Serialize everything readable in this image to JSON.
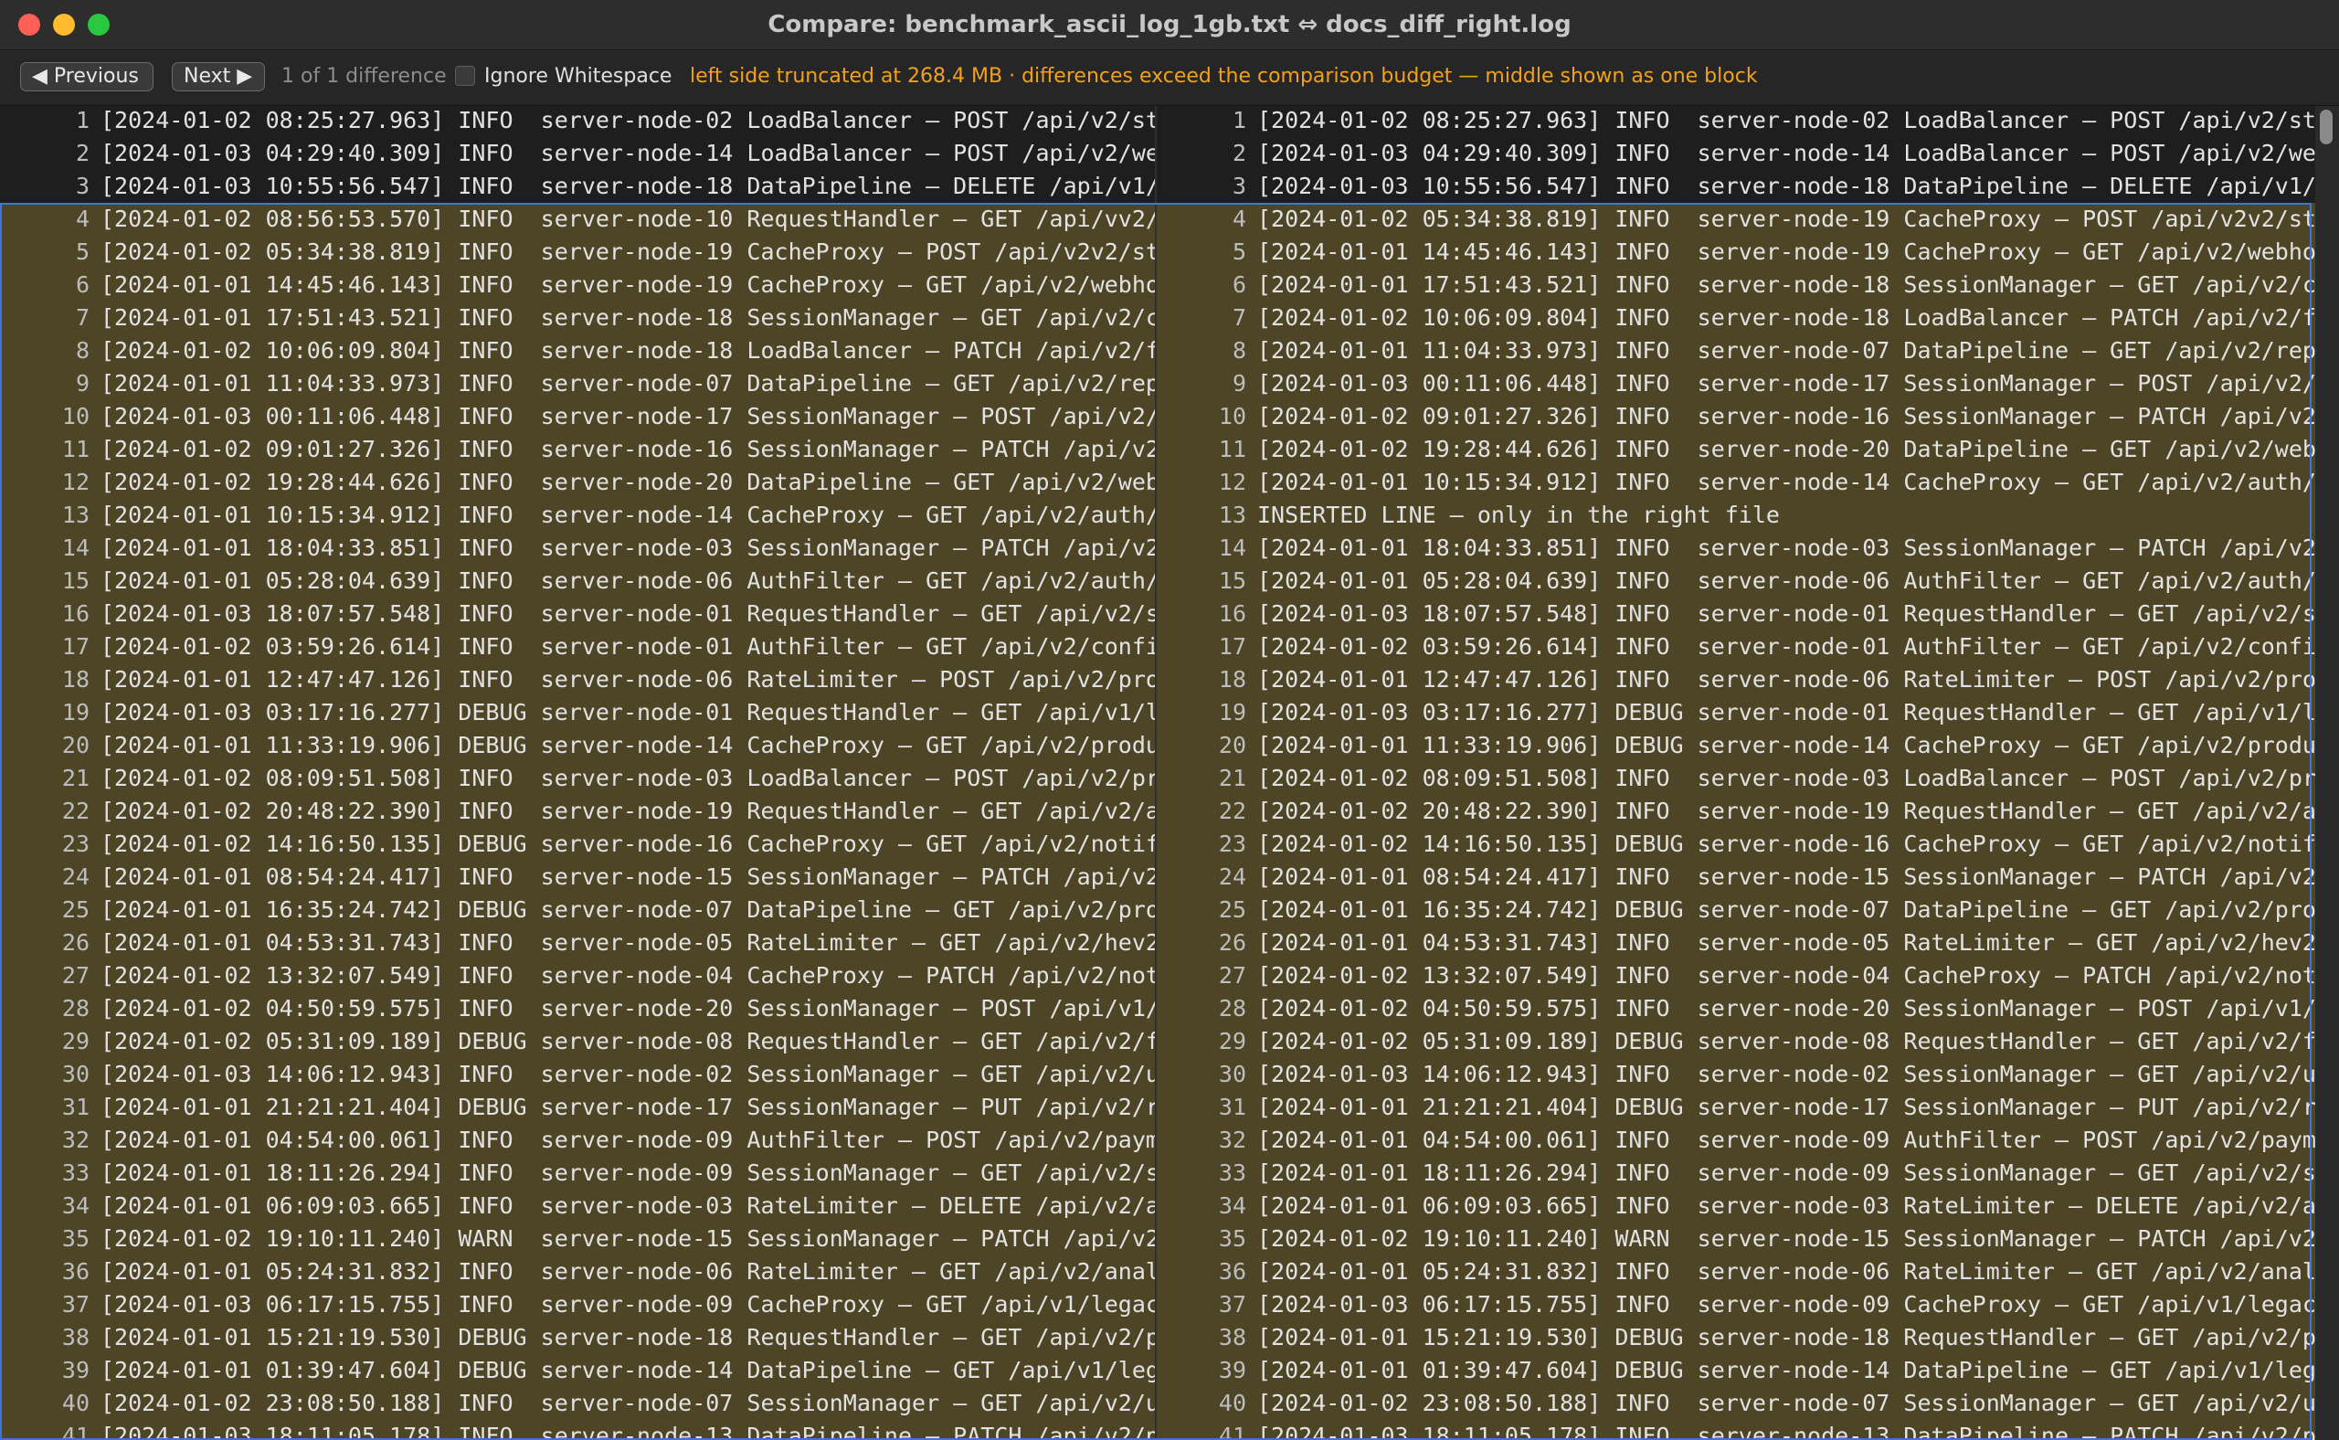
{
  "window": {
    "title": "Compare: benchmark_ascii_log_1gb.txt ⇔ docs_diff_right.log"
  },
  "toolbar": {
    "previous_label": "◀ Previous",
    "next_label": "Next ▶",
    "count_text": "1 of 1 difference",
    "ignore_whitespace_label": "Ignore Whitespace",
    "ignore_whitespace_checked": false,
    "warning_text": "left side truncated at 268.4 MB · differences exceed the comparison budget — middle shown as one block"
  },
  "colors": {
    "changed_background": "#4d4526",
    "block_outline": "#3d74d8",
    "warning": "#f0a21a"
  },
  "left_lines": [
    {
      "n": "1",
      "text": "[2024-01-02 08:25:27.963] INFO  server-node-02 LoadBalancer — POST /api/v2/st",
      "changed": false
    },
    {
      "n": "2",
      "text": "[2024-01-03 04:29:40.309] INFO  server-node-14 LoadBalancer — POST /api/v2/we",
      "changed": false
    },
    {
      "n": "3",
      "text": "[2024-01-03 10:55:56.547] INFO  server-node-18 DataPipeline — DELETE /api/v1/",
      "changed": false
    },
    {
      "n": "4",
      "text": "[2024-01-02 08:56:53.570] INFO  server-node-10 RequestHandler — GET /api/vv2/",
      "changed": true
    },
    {
      "n": "5",
      "text": "[2024-01-02 05:34:38.819] INFO  server-node-19 CacheProxy — POST /api/v2v2/st",
      "changed": true
    },
    {
      "n": "6",
      "text": "[2024-01-01 14:45:46.143] INFO  server-node-19 CacheProxy — GET /api/v2/webho",
      "changed": true
    },
    {
      "n": "7",
      "text": "[2024-01-01 17:51:43.521] INFO  server-node-18 SessionManager — GET /api/v2/c",
      "changed": true
    },
    {
      "n": "8",
      "text": "[2024-01-02 10:06:09.804] INFO  server-node-18 LoadBalancer — PATCH /api/v2/f",
      "changed": true
    },
    {
      "n": "9",
      "text": "[2024-01-01 11:04:33.973] INFO  server-node-07 DataPipeline — GET /api/v2/rep",
      "changed": true
    },
    {
      "n": "10",
      "text": "[2024-01-03 00:11:06.448] INFO  server-node-17 SessionManager — POST /api/v2/",
      "changed": true
    },
    {
      "n": "11",
      "text": "[2024-01-02 09:01:27.326] INFO  server-node-16 SessionManager — PATCH /api/v2",
      "changed": true
    },
    {
      "n": "12",
      "text": "[2024-01-02 19:28:44.626] INFO  server-node-20 DataPipeline — GET /api/v2/web",
      "changed": true
    },
    {
      "n": "13",
      "text": "[2024-01-01 10:15:34.912] INFO  server-node-14 CacheProxy — GET /api/v2/auth/",
      "changed": true
    },
    {
      "n": "14",
      "text": "[2024-01-01 18:04:33.851] INFO  server-node-03 SessionManager — PATCH /api/v2",
      "changed": true
    },
    {
      "n": "15",
      "text": "[2024-01-01 05:28:04.639] INFO  server-node-06 AuthFilter — GET /api/v2/auth/",
      "changed": true
    },
    {
      "n": "16",
      "text": "[2024-01-03 18:07:57.548] INFO  server-node-01 RequestHandler — GET /api/v2/s",
      "changed": true
    },
    {
      "n": "17",
      "text": "[2024-01-02 03:59:26.614] INFO  server-node-01 AuthFilter — GET /api/v2/confi",
      "changed": true
    },
    {
      "n": "18",
      "text": "[2024-01-01 12:47:47.126] INFO  server-node-06 RateLimiter — POST /api/v2/pro",
      "changed": true
    },
    {
      "n": "19",
      "text": "[2024-01-03 03:17:16.277] DEBUG server-node-01 RequestHandler — GET /api/v1/l",
      "changed": true
    },
    {
      "n": "20",
      "text": "[2024-01-01 11:33:19.906] DEBUG server-node-14 CacheProxy — GET /api/v2/produ",
      "changed": true
    },
    {
      "n": "21",
      "text": "[2024-01-02 08:09:51.508] INFO  server-node-03 LoadBalancer — POST /api/v2/pr",
      "changed": true
    },
    {
      "n": "22",
      "text": "[2024-01-02 20:48:22.390] INFO  server-node-19 RequestHandler — GET /api/v2/a",
      "changed": true
    },
    {
      "n": "23",
      "text": "[2024-01-02 14:16:50.135] DEBUG server-node-16 CacheProxy — GET /api/v2/notif",
      "changed": true
    },
    {
      "n": "24",
      "text": "[2024-01-01 08:54:24.417] INFO  server-node-15 SessionManager — PATCH /api/v2",
      "changed": true
    },
    {
      "n": "25",
      "text": "[2024-01-01 16:35:24.742] DEBUG server-node-07 DataPipeline — GET /api/v2/pro",
      "changed": true
    },
    {
      "n": "26",
      "text": "[2024-01-01 04:53:31.743] INFO  server-node-05 RateLimiter — GET /api/v2/hev2",
      "changed": true
    },
    {
      "n": "27",
      "text": "[2024-01-02 13:32:07.549] INFO  server-node-04 CacheProxy — PATCH /api/v2/not",
      "changed": true
    },
    {
      "n": "28",
      "text": "[2024-01-02 04:50:59.575] INFO  server-node-20 SessionManager — POST /api/v1/",
      "changed": true
    },
    {
      "n": "29",
      "text": "[2024-01-02 05:31:09.189] DEBUG server-node-08 RequestHandler — GET /api/v2/f",
      "changed": true
    },
    {
      "n": "30",
      "text": "[2024-01-03 14:06:12.943] INFO  server-node-02 SessionManager — GET /api/v2/u",
      "changed": true
    },
    {
      "n": "31",
      "text": "[2024-01-01 21:21:21.404] DEBUG server-node-17 SessionManager — PUT /api/v2/r",
      "changed": true
    },
    {
      "n": "32",
      "text": "[2024-01-01 04:54:00.061] INFO  server-node-09 AuthFilter — POST /api/v2/paym",
      "changed": true
    },
    {
      "n": "33",
      "text": "[2024-01-01 18:11:26.294] INFO  server-node-09 SessionManager — GET /api/v2/s",
      "changed": true
    },
    {
      "n": "34",
      "text": "[2024-01-01 06:09:03.665] INFO  server-node-03 RateLimiter — DELETE /api/v2/a",
      "changed": true
    },
    {
      "n": "35",
      "text": "[2024-01-02 19:10:11.240] WARN  server-node-15 SessionManager — PATCH /api/v2",
      "changed": true
    },
    {
      "n": "36",
      "text": "[2024-01-01 05:24:31.832] INFO  server-node-06 RateLimiter — GET /api/v2/anal",
      "changed": true
    },
    {
      "n": "37",
      "text": "[2024-01-03 06:17:15.755] INFO  server-node-09 CacheProxy — GET /api/v1/legac",
      "changed": true
    },
    {
      "n": "38",
      "text": "[2024-01-01 15:21:19.530] DEBUG server-node-18 RequestHandler — GET /api/v2/p",
      "changed": true
    },
    {
      "n": "39",
      "text": "[2024-01-01 01:39:47.604] DEBUG server-node-14 DataPipeline — GET /api/v1/leg",
      "changed": true
    },
    {
      "n": "40",
      "text": "[2024-01-02 23:08:50.188] INFO  server-node-07 SessionManager — GET /api/v2/u",
      "changed": true
    },
    {
      "n": "41",
      "text": "[2024-01-03 18:11:05.178] INFO  server-node-13 DataPipeline — PATCH /api/v2/p",
      "changed": true
    }
  ],
  "right_lines": [
    {
      "n": "1",
      "text": "[2024-01-02 08:25:27.963] INFO  server-node-02 LoadBalancer — POST /api/v2/st",
      "changed": false
    },
    {
      "n": "2",
      "text": "[2024-01-03 04:29:40.309] INFO  server-node-14 LoadBalancer — POST /api/v2/we",
      "changed": false
    },
    {
      "n": "3",
      "text": "[2024-01-03 10:55:56.547] INFO  server-node-18 DataPipeline — DELETE /api/v1/",
      "changed": false
    },
    {
      "n": "4",
      "text": "[2024-01-02 05:34:38.819] INFO  server-node-19 CacheProxy — POST /api/v2v2/st",
      "changed": true
    },
    {
      "n": "5",
      "text": "[2024-01-01 14:45:46.143] INFO  server-node-19 CacheProxy — GET /api/v2/webho",
      "changed": true
    },
    {
      "n": "6",
      "text": "[2024-01-01 17:51:43.521] INFO  server-node-18 SessionManager — GET /api/v2/c",
      "changed": true
    },
    {
      "n": "7",
      "text": "[2024-01-02 10:06:09.804] INFO  server-node-18 LoadBalancer — PATCH /api/v2/f",
      "changed": true
    },
    {
      "n": "8",
      "text": "[2024-01-01 11:04:33.973] INFO  server-node-07 DataPipeline — GET /api/v2/rep",
      "changed": true
    },
    {
      "n": "9",
      "text": "[2024-01-03 00:11:06.448] INFO  server-node-17 SessionManager — POST /api/v2/",
      "changed": true
    },
    {
      "n": "10",
      "text": "[2024-01-02 09:01:27.326] INFO  server-node-16 SessionManager — PATCH /api/v2",
      "changed": true
    },
    {
      "n": "11",
      "text": "[2024-01-02 19:28:44.626] INFO  server-node-20 DataPipeline — GET /api/v2/web",
      "changed": true
    },
    {
      "n": "12",
      "text": "[2024-01-01 10:15:34.912] INFO  server-node-14 CacheProxy — GET /api/v2/auth/",
      "changed": true
    },
    {
      "n": "13",
      "text": "INSERTED LINE — only in the right file",
      "changed": true
    },
    {
      "n": "14",
      "text": "[2024-01-01 18:04:33.851] INFO  server-node-03 SessionManager — PATCH /api/v2",
      "changed": true
    },
    {
      "n": "15",
      "text": "[2024-01-01 05:28:04.639] INFO  server-node-06 AuthFilter — GET /api/v2/auth/",
      "changed": true
    },
    {
      "n": "16",
      "text": "[2024-01-03 18:07:57.548] INFO  server-node-01 RequestHandler — GET /api/v2/s",
      "changed": true
    },
    {
      "n": "17",
      "text": "[2024-01-02 03:59:26.614] INFO  server-node-01 AuthFilter — GET /api/v2/confi",
      "changed": true
    },
    {
      "n": "18",
      "text": "[2024-01-01 12:47:47.126] INFO  server-node-06 RateLimiter — POST /api/v2/pro",
      "changed": true
    },
    {
      "n": "19",
      "text": "[2024-01-03 03:17:16.277] DEBUG server-node-01 RequestHandler — GET /api/v1/l",
      "changed": true
    },
    {
      "n": "20",
      "text": "[2024-01-01 11:33:19.906] DEBUG server-node-14 CacheProxy — GET /api/v2/produ",
      "changed": true
    },
    {
      "n": "21",
      "text": "[2024-01-02 08:09:51.508] INFO  server-node-03 LoadBalancer — POST /api/v2/pr",
      "changed": true
    },
    {
      "n": "22",
      "text": "[2024-01-02 20:48:22.390] INFO  server-node-19 RequestHandler — GET /api/v2/a",
      "changed": true
    },
    {
      "n": "23",
      "text": "[2024-01-02 14:16:50.135] DEBUG server-node-16 CacheProxy — GET /api/v2/notif",
      "changed": true
    },
    {
      "n": "24",
      "text": "[2024-01-01 08:54:24.417] INFO  server-node-15 SessionManager — PATCH /api/v2",
      "changed": true
    },
    {
      "n": "25",
      "text": "[2024-01-01 16:35:24.742] DEBUG server-node-07 DataPipeline — GET /api/v2/pro",
      "changed": true
    },
    {
      "n": "26",
      "text": "[2024-01-01 04:53:31.743] INFO  server-node-05 RateLimiter — GET /api/v2/hev2",
      "changed": true
    },
    {
      "n": "27",
      "text": "[2024-01-02 13:32:07.549] INFO  server-node-04 CacheProxy — PATCH /api/v2/not",
      "changed": true
    },
    {
      "n": "28",
      "text": "[2024-01-02 04:50:59.575] INFO  server-node-20 SessionManager — POST /api/v1/",
      "changed": true
    },
    {
      "n": "29",
      "text": "[2024-01-02 05:31:09.189] DEBUG server-node-08 RequestHandler — GET /api/v2/f",
      "changed": true
    },
    {
      "n": "30",
      "text": "[2024-01-03 14:06:12.943] INFO  server-node-02 SessionManager — GET /api/v2/u",
      "changed": true
    },
    {
      "n": "31",
      "text": "[2024-01-01 21:21:21.404] DEBUG server-node-17 SessionManager — PUT /api/v2/r",
      "changed": true
    },
    {
      "n": "32",
      "text": "[2024-01-01 04:54:00.061] INFO  server-node-09 AuthFilter — POST /api/v2/paym",
      "changed": true
    },
    {
      "n": "33",
      "text": "[2024-01-01 18:11:26.294] INFO  server-node-09 SessionManager — GET /api/v2/s",
      "changed": true
    },
    {
      "n": "34",
      "text": "[2024-01-01 06:09:03.665] INFO  server-node-03 RateLimiter — DELETE /api/v2/a",
      "changed": true
    },
    {
      "n": "35",
      "text": "[2024-01-02 19:10:11.240] WARN  server-node-15 SessionManager — PATCH /api/v2",
      "changed": true
    },
    {
      "n": "36",
      "text": "[2024-01-01 05:24:31.832] INFO  server-node-06 RateLimiter — GET /api/v2/anal",
      "changed": true
    },
    {
      "n": "37",
      "text": "[2024-01-03 06:17:15.755] INFO  server-node-09 CacheProxy — GET /api/v1/legac",
      "changed": true
    },
    {
      "n": "38",
      "text": "[2024-01-01 15:21:19.530] DEBUG server-node-18 RequestHandler — GET /api/v2/p",
      "changed": true
    },
    {
      "n": "39",
      "text": "[2024-01-01 01:39:47.604] DEBUG server-node-14 DataPipeline — GET /api/v1/leg",
      "changed": true
    },
    {
      "n": "40",
      "text": "[2024-01-02 23:08:50.188] INFO  server-node-07 SessionManager — GET /api/v2/u",
      "changed": true
    },
    {
      "n": "41",
      "text": "[2024-01-03 18:11:05.178] INFO  server-node-13 DataPipeline — PATCH /api/v2/p",
      "changed": true
    }
  ]
}
